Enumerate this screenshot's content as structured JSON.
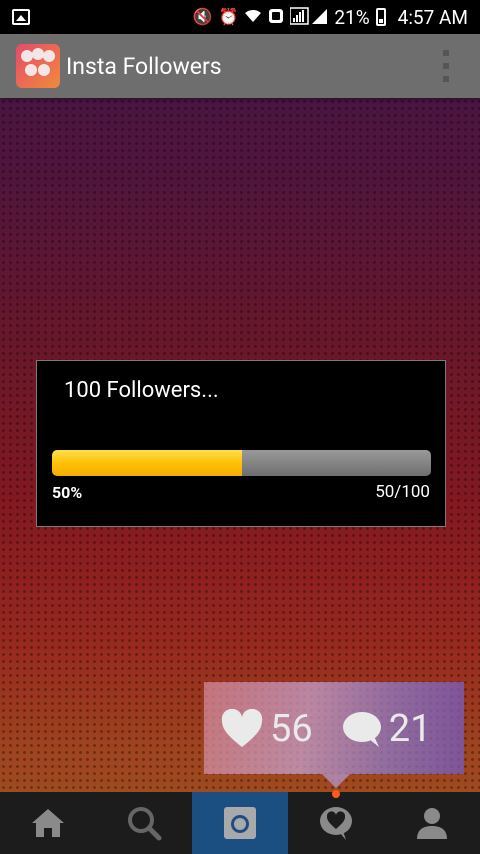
{
  "status_bar": {
    "battery_percent": "21%",
    "time": "4:57 AM",
    "icons": [
      "image-notification-icon",
      "mute-icon",
      "alarm-icon",
      "wifi-icon",
      "nfc-icon",
      "signal-icon",
      "battery-icon"
    ]
  },
  "app_bar": {
    "title": "Insta Followers",
    "icon": "app-logo-icon",
    "menu_icon": "overflow-menu-icon"
  },
  "dialog": {
    "title": "100 Followers...",
    "progress_fraction": 0.5,
    "progress_percent_label": "50%",
    "progress_count_label": "50/100"
  },
  "likes_card": {
    "likes": "56",
    "comments": "21"
  },
  "bottom_nav": {
    "items": [
      "home",
      "search",
      "camera",
      "activity",
      "profile"
    ],
    "active": "camera"
  },
  "colors": {
    "progress_fill": "#ffc107",
    "progress_track": "#888888",
    "action_bar": "#6e6e6e",
    "nav_active": "#1b4f82"
  }
}
